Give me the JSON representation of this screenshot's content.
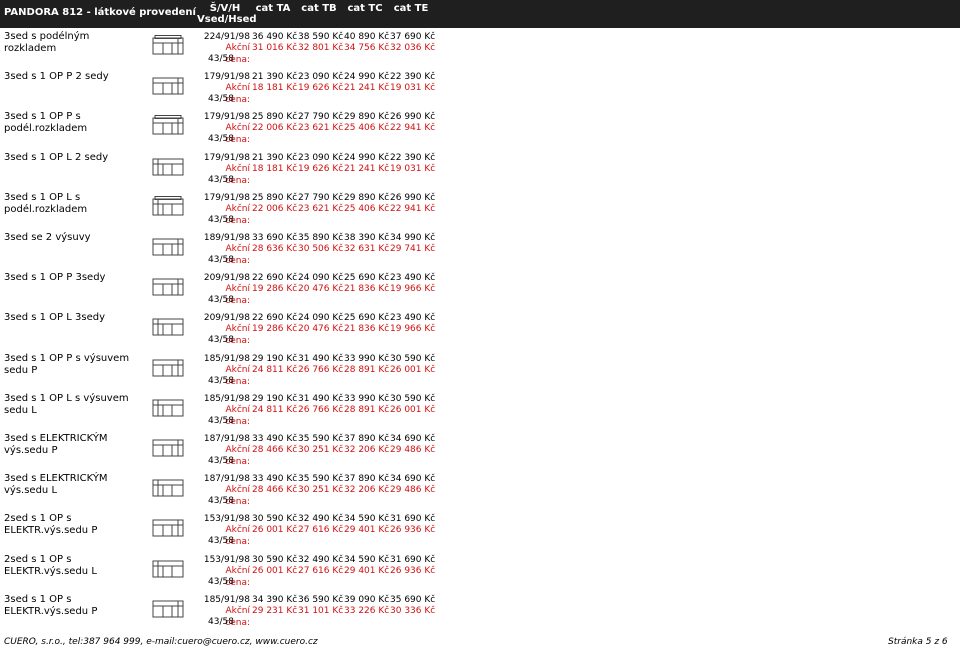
{
  "header": {
    "title": "PANDORA 812 - látkové provedení",
    "dim_col_line1": "Š/V/H",
    "dim_col_line2": "Vsed/Hsed",
    "categories": [
      "cat TA",
      "cat TB",
      "cat TC",
      "cat TE"
    ]
  },
  "price_label": "Akční cena:",
  "rows": [
    {
      "name": "3sed s podélným rozkladem",
      "dims": "224/91/98",
      "code": "43/58",
      "icon": "sofa-long-icon",
      "prices": [
        "36 490 Kč",
        "38 590 Kč",
        "40 890 Kč",
        "37 690 Kč"
      ],
      "sale": [
        "31 016 Kč",
        "32 801 Kč",
        "34 756 Kč",
        "32 036 Kč"
      ]
    },
    {
      "name": "3sed s 1 OP P 2 sedy",
      "dims": "179/91/98",
      "code": "43/58",
      "icon": "sofa-arm-right-icon",
      "prices": [
        "21 390 Kč",
        "23 090 Kč",
        "24 990 Kč",
        "22 390 Kč"
      ],
      "sale": [
        "18 181 Kč",
        "19 626 Kč",
        "21 241 Kč",
        "19 031 Kč"
      ]
    },
    {
      "name": "3sed s 1 OP P s podél.rozkladem",
      "dims": "179/91/98",
      "code": "43/58",
      "icon": "sofa-bed-right-icon",
      "prices": [
        "25 890 Kč",
        "27 790 Kč",
        "29 890 Kč",
        "26 990 Kč"
      ],
      "sale": [
        "22 006 Kč",
        "23 621 Kč",
        "25 406 Kč",
        "22 941 Kč"
      ]
    },
    {
      "name": "3sed s 1 OP L 2 sedy",
      "dims": "179/91/98",
      "code": "43/58",
      "icon": "sofa-arm-left-icon",
      "prices": [
        "21 390 Kč",
        "23 090 Kč",
        "24 990 Kč",
        "22 390 Kč"
      ],
      "sale": [
        "18 181 Kč",
        "19 626 Kč",
        "21 241 Kč",
        "19 031 Kč"
      ]
    },
    {
      "name": "3sed s 1 OP L s podél.rozkladem",
      "dims": "179/91/98",
      "code": "43/58",
      "icon": "sofa-bed-left-icon",
      "prices": [
        "25 890 Kč",
        "27 790 Kč",
        "29 890 Kč",
        "26 990 Kč"
      ],
      "sale": [
        "22 006 Kč",
        "23 621 Kč",
        "25 406 Kč",
        "22 941 Kč"
      ]
    },
    {
      "name": "3sed se 2 výsuvy",
      "dims": "189/91/98",
      "code": "43/58",
      "icon": "sofa-two-extend-icon",
      "prices": [
        "33 690 Kč",
        "35 890 Kč",
        "38 390 Kč",
        "34 990 Kč"
      ],
      "sale": [
        "28 636 Kč",
        "30 506 Kč",
        "32 631 Kč",
        "29 741 Kč"
      ]
    },
    {
      "name": "3sed s 1 OP P 3sedy",
      "dims": "209/91/98",
      "code": "43/58",
      "icon": "sofa-three-right-icon",
      "prices": [
        "22 690 Kč",
        "24 090 Kč",
        "25 690 Kč",
        "23 490 Kč"
      ],
      "sale": [
        "19 286 Kč",
        "20 476 Kč",
        "21 836 Kč",
        "19 966 Kč"
      ]
    },
    {
      "name": "3sed s 1 OP L 3sedy",
      "dims": "209/91/98",
      "code": "43/58",
      "icon": "sofa-three-left-icon",
      "prices": [
        "22 690 Kč",
        "24 090 Kč",
        "25 690 Kč",
        "23 490 Kč"
      ],
      "sale": [
        "19 286 Kč",
        "20 476 Kč",
        "21 836 Kč",
        "19 966 Kč"
      ]
    },
    {
      "name": "3sed s 1 OP P s výsuvem sedu P",
      "dims": "185/91/98",
      "code": "43/58",
      "icon": "sofa-extend-right-icon",
      "prices": [
        "29 190 Kč",
        "31 490 Kč",
        "33 990 Kč",
        "30 590 Kč"
      ],
      "sale": [
        "24 811 Kč",
        "26 766 Kč",
        "28 891 Kč",
        "26 001 Kč"
      ]
    },
    {
      "name": "3sed s 1 OP L s výsuvem sedu L",
      "dims": "185/91/98",
      "code": "43/58",
      "icon": "sofa-extend-left-icon",
      "prices": [
        "29 190 Kč",
        "31 490 Kč",
        "33 990 Kč",
        "30 590 Kč"
      ],
      "sale": [
        "24 811 Kč",
        "26 766 Kč",
        "28 891 Kč",
        "26 001 Kč"
      ]
    },
    {
      "name": "3sed s ELEKTRICKÝM výs.sedu P",
      "dims": "187/91/98",
      "code": "43/58",
      "icon": "sofa-electric-right-icon",
      "prices": [
        "33 490 Kč",
        "35 590 Kč",
        "37 890 Kč",
        "34 690 Kč"
      ],
      "sale": [
        "28 466 Kč",
        "30 251 Kč",
        "32 206 Kč",
        "29 486 Kč"
      ]
    },
    {
      "name": "3sed s ELEKTRICKÝM výs.sedu L",
      "dims": "187/91/98",
      "code": "43/58",
      "icon": "sofa-electric-left-icon",
      "prices": [
        "33 490 Kč",
        "35 590 Kč",
        "37 890 Kč",
        "34 690 Kč"
      ],
      "sale": [
        "28 466 Kč",
        "30 251 Kč",
        "32 206 Kč",
        "29 486 Kč"
      ]
    },
    {
      "name": "2sed s 1 OP s ELEKTR.výs.sedu P",
      "dims": "153/91/98",
      "code": "43/58",
      "icon": "sofa-2-electric-right-icon",
      "prices": [
        "30 590 Kč",
        "32 490 Kč",
        "34 590 Kč",
        "31 690 Kč"
      ],
      "sale": [
        "26 001 Kč",
        "27 616 Kč",
        "29 401 Kč",
        "26 936 Kč"
      ]
    },
    {
      "name": "2sed s 1 OP s ELEKTR.výs.sedu L",
      "dims": "153/91/98",
      "code": "43/58",
      "icon": "sofa-2-electric-left-icon",
      "prices": [
        "30 590 Kč",
        "32 490 Kč",
        "34 590 Kč",
        "31 690 Kč"
      ],
      "sale": [
        "26 001 Kč",
        "27 616 Kč",
        "29 401 Kč",
        "26 936 Kč"
      ]
    },
    {
      "name": "3sed s 1 OP s ELEKTR.výs.sedu P",
      "dims": "185/91/98",
      "code": "43/58",
      "icon": "sofa-3-electric-right-icon",
      "prices": [
        "34 390 Kč",
        "36 590 Kč",
        "39 090 Kč",
        "35 690 Kč"
      ],
      "sale": [
        "29 231 Kč",
        "31 101 Kč",
        "33 226 Kč",
        "30 336 Kč"
      ]
    }
  ],
  "footer": {
    "left": "CUERO, s.r.o., tel:387 964 999, e-mail:cuero@cuero.cz, www.cuero.cz",
    "right": "Stránka 5 z 6"
  },
  "colors": {
    "header_bg": "#1f1f1f",
    "sale_text": "#d01010"
  }
}
